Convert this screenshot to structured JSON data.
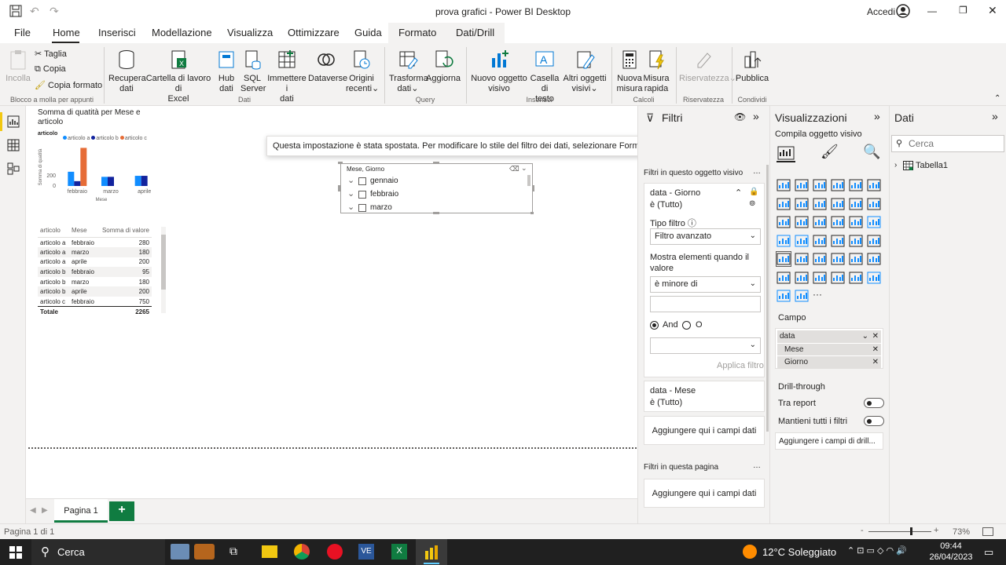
{
  "window": {
    "title": "prova grafici - Power BI Desktop",
    "account": "Accedi"
  },
  "tabs": [
    "File",
    "Home",
    "Inserisci",
    "Modellazione",
    "Visualizza",
    "Ottimizzare",
    "Guida",
    "Formato",
    "Dati/Drill"
  ],
  "ribbon": {
    "clipboard": {
      "paste": "Incolla",
      "cut": "Taglia",
      "copy": "Copia",
      "format_painter": "Copia formato",
      "group": "Blocco a molla per appunti"
    },
    "data": {
      "get_data": [
        "Recupera",
        "dati"
      ],
      "excel": [
        "Cartella di lavoro di",
        "Excel"
      ],
      "hub": [
        "Hub",
        "dati"
      ],
      "sql": [
        "SQL",
        "Server"
      ],
      "enter": [
        "Immettere i",
        "dati"
      ],
      "dataverse": [
        "Dataverse",
        ""
      ],
      "recent": [
        "Origini",
        "recenti"
      ],
      "group": "Dati"
    },
    "query": {
      "transform": [
        "Trasforma",
        "dati"
      ],
      "refresh": [
        "Aggiorna",
        ""
      ],
      "group": "Query"
    },
    "insert": {
      "new_visual": [
        "Nuovo oggetto",
        "visivo"
      ],
      "textbox": [
        "Casella di",
        "testo"
      ],
      "more": [
        "Altri oggetti",
        "visivi"
      ],
      "group": "Inserisci"
    },
    "calc": {
      "new_measure": [
        "Nuova",
        "misura"
      ],
      "quick_measure": [
        "Misura",
        "rapida"
      ],
      "group": "Calcoli"
    },
    "privacy": {
      "sensitivity": [
        "Riservatezza",
        ""
      ],
      "group": "Riservatezza"
    },
    "share": {
      "publish": [
        "Pubblica",
        ""
      ],
      "group": "Condividi"
    }
  },
  "chart": {
    "title": "Somma di quatità per Mese e articolo",
    "legend_title": "articolo",
    "ylabel": "Somma di quatità",
    "xlabel": "Mese",
    "yticks": [
      "200",
      "0"
    ]
  },
  "chart_data": {
    "type": "bar",
    "title": "Somma di quatità per Mese e articolo",
    "xlabel": "Mese",
    "ylabel": "Somma di quatità",
    "categories": [
      "febbraio",
      "marzo",
      "aprile"
    ],
    "series": [
      {
        "name": "articolo a",
        "color": "#118DFF",
        "values": [
          280,
          180,
          200
        ]
      },
      {
        "name": "articolo b",
        "color": "#12239E",
        "values": [
          95,
          180,
          200
        ]
      },
      {
        "name": "articolo c",
        "color": "#E66C37",
        "values": [
          750,
          0,
          0
        ]
      }
    ],
    "ylim": [
      0,
      800
    ],
    "legend": "top-left"
  },
  "table": {
    "headers": [
      "articolo",
      "Mese",
      "Somma di valore"
    ],
    "rows": [
      [
        "articolo a",
        "febbraio",
        "280"
      ],
      [
        "articolo a",
        "marzo",
        "180"
      ],
      [
        "articolo a",
        "aprile",
        "200"
      ],
      [
        "articolo b",
        "febbraio",
        "95"
      ],
      [
        "articolo b",
        "marzo",
        "180"
      ],
      [
        "articolo b",
        "aprile",
        "200"
      ],
      [
        "articolo c",
        "febbraio",
        "750"
      ]
    ],
    "total_label": "Totale",
    "total_value": "2265"
  },
  "slicer": {
    "title": "Mese, Giorno",
    "items": [
      "gennaio",
      "febbraio",
      "marzo"
    ]
  },
  "tooltip": "Questa impostazione è stata spostata. Per modificare lo stile del filtro dei dati, selezionare Formato > impostazioni filtro dei dati > Opzioni > Stile.",
  "filters": {
    "title": "Filtri",
    "visual_section": "Filtri in questo oggetto visivo",
    "card1_title": "data - Giorno",
    "card1_sub": "è (Tutto)",
    "filter_type_label": "Tipo filtro",
    "filter_type_value": "Filtro avanzato",
    "show_items_label": "Mostra elementi quando il valore",
    "condition_value": "è minore di",
    "and_label": "And",
    "or_label": "O",
    "apply": "Applica filtro",
    "card2_title": "data - Mese",
    "card2_sub": "è (Tutto)",
    "add_fields": "Aggiungere qui i campi dati",
    "page_section": "Filtri in questa pagina",
    "add_fields_page": "Aggiungere qui i campi dati"
  },
  "viz": {
    "title": "Visualizzazioni",
    "build": "Compila oggetto visivo",
    "field_section": "Campo",
    "field_main": "data",
    "field_items": [
      "Mese",
      "Giorno"
    ],
    "drill_section": "Drill-through",
    "cross_report": "Tra report",
    "keep_filters": "Mantieni tutti i filtri",
    "add_drill": "Aggiungere i campi di drill..."
  },
  "dati": {
    "title": "Dati",
    "search_placeholder": "Cerca",
    "table": "Tabella1"
  },
  "pages": {
    "page1": "Pagina 1",
    "add": "+"
  },
  "status": {
    "page": "Pagina 1 di 1",
    "zoom": "73%"
  },
  "taskbar": {
    "search": "Cerca",
    "weather": "12°C  Soleggiato",
    "time": "09:44",
    "date": "26/04/2023"
  }
}
